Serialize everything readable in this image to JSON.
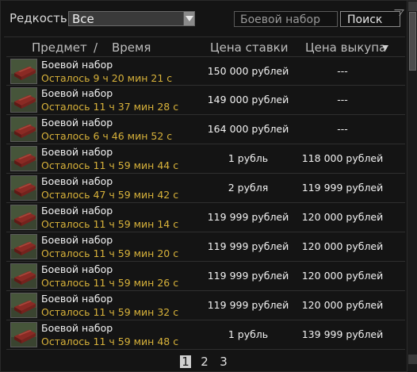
{
  "filters": {
    "rarity_label": "Редкость",
    "rarity_value": "Все",
    "search_value": "Боевой набор",
    "search_button": "Поиск"
  },
  "columns": {
    "item": "Предмет",
    "separator": "/",
    "time": "Время",
    "bid": "Цена ставки",
    "buyout": "Цена выкупа"
  },
  "rows": [
    {
      "name": "Боевой набор",
      "time_left": "Осталось 9 ч 20 мин 21 с",
      "bid": "150 000 рублей",
      "buyout": "---"
    },
    {
      "name": "Боевой набор",
      "time_left": "Осталось 11 ч 37 мин 28 с",
      "bid": "149 000 рублей",
      "buyout": "---"
    },
    {
      "name": "Боевой набор",
      "time_left": "Осталось 6 ч 46 мин 52 с",
      "bid": "164 000 рублей",
      "buyout": "---"
    },
    {
      "name": "Боевой набор",
      "time_left": "Осталось 11 ч 59 мин 44 с",
      "bid": "1 рубль",
      "buyout": "118 000 рублей"
    },
    {
      "name": "Боевой набор",
      "time_left": "Осталось 47 ч 59 мин 42 с",
      "bid": "2 рубля",
      "buyout": "119 999 рублей"
    },
    {
      "name": "Боевой набор",
      "time_left": "Осталось 11 ч 59 мин 14 с",
      "bid": "119 999 рублей",
      "buyout": "120 000 рублей"
    },
    {
      "name": "Боевой набор",
      "time_left": "Осталось 11 ч 59 мин 20 с",
      "bid": "119 999 рублей",
      "buyout": "120 000 рублей"
    },
    {
      "name": "Боевой набор",
      "time_left": "Осталось 11 ч 59 мин 26 с",
      "bid": "119 999 рублей",
      "buyout": "120 000 рублей"
    },
    {
      "name": "Боевой набор",
      "time_left": "Осталось 11 ч 59 мин 32 с",
      "bid": "119 999 рублей",
      "buyout": "120 000 рублей"
    },
    {
      "name": "Боевой набор",
      "time_left": "Осталось 11 ч 59 мин 48 с",
      "bid": "1 рубль",
      "buyout": "139 999 рублей"
    }
  ],
  "pagination": {
    "pages": [
      "1",
      "2",
      "3"
    ],
    "active": "1"
  },
  "icons": {
    "item": "battle-kit-icon",
    "rarity_dropdown": "chevron-down-icon",
    "sort": "sort-down-icon"
  },
  "colors": {
    "time_left": "#d8b23a",
    "text": "#f2f2f2",
    "background": "#141414"
  }
}
